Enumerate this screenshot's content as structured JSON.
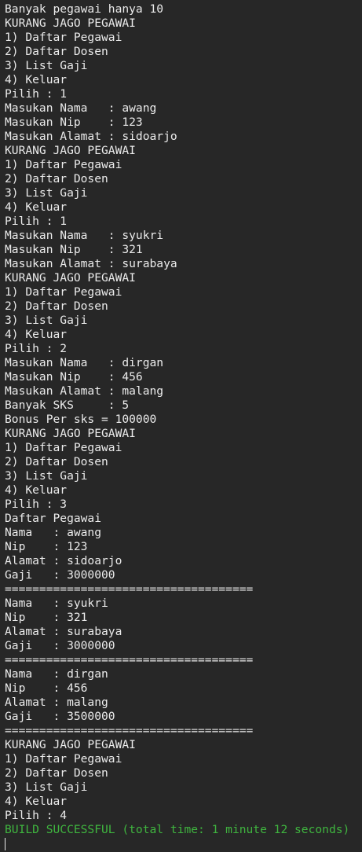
{
  "console": {
    "lines": [
      "Banyak pegawai hanya 10",
      "KURANG JAGO PEGAWAI",
      "1) Daftar Pegawai",
      "2) Daftar Dosen",
      "3) List Gaji",
      "4) Keluar",
      "Pilih : 1",
      "Masukan Nama   : awang",
      "Masukan Nip    : 123",
      "Masukan Alamat : sidoarjo",
      "KURANG JAGO PEGAWAI",
      "1) Daftar Pegawai",
      "2) Daftar Dosen",
      "3) List Gaji",
      "4) Keluar",
      "Pilih : 1",
      "Masukan Nama   : syukri",
      "Masukan Nip    : 321",
      "Masukan Alamat : surabaya",
      "KURANG JAGO PEGAWAI",
      "1) Daftar Pegawai",
      "2) Daftar Dosen",
      "3) List Gaji",
      "4) Keluar",
      "Pilih : 2",
      "Masukan Nama   : dirgan",
      "Masukan Nip    : 456",
      "Masukan Alamat : malang",
      "Banyak SKS     : 5",
      "Bonus Per sks = 100000",
      "KURANG JAGO PEGAWAI",
      "1) Daftar Pegawai",
      "2) Daftar Dosen",
      "3) List Gaji",
      "4) Keluar",
      "Pilih : 3",
      "Daftar Pegawai",
      "Nama   : awang",
      "Nip    : 123",
      "Alamat : sidoarjo",
      "Gaji   : 3000000",
      "====================================",
      "Nama   : syukri",
      "Nip    : 321",
      "Alamat : surabaya",
      "Gaji   : 3000000",
      "====================================",
      "Nama   : dirgan",
      "Nip    : 456",
      "Alamat : malang",
      "Gaji   : 3500000",
      "====================================",
      "KURANG JAGO PEGAWAI",
      "1) Daftar Pegawai",
      "2) Daftar Dosen",
      "3) List Gaji",
      "4) Keluar",
      "Pilih : 4"
    ],
    "status": "BUILD SUCCESSFUL (total time: 1 minute 12 seconds)"
  },
  "colors": {
    "background": "#272727",
    "text": "#ebebeb",
    "success": "#3fb53f"
  }
}
